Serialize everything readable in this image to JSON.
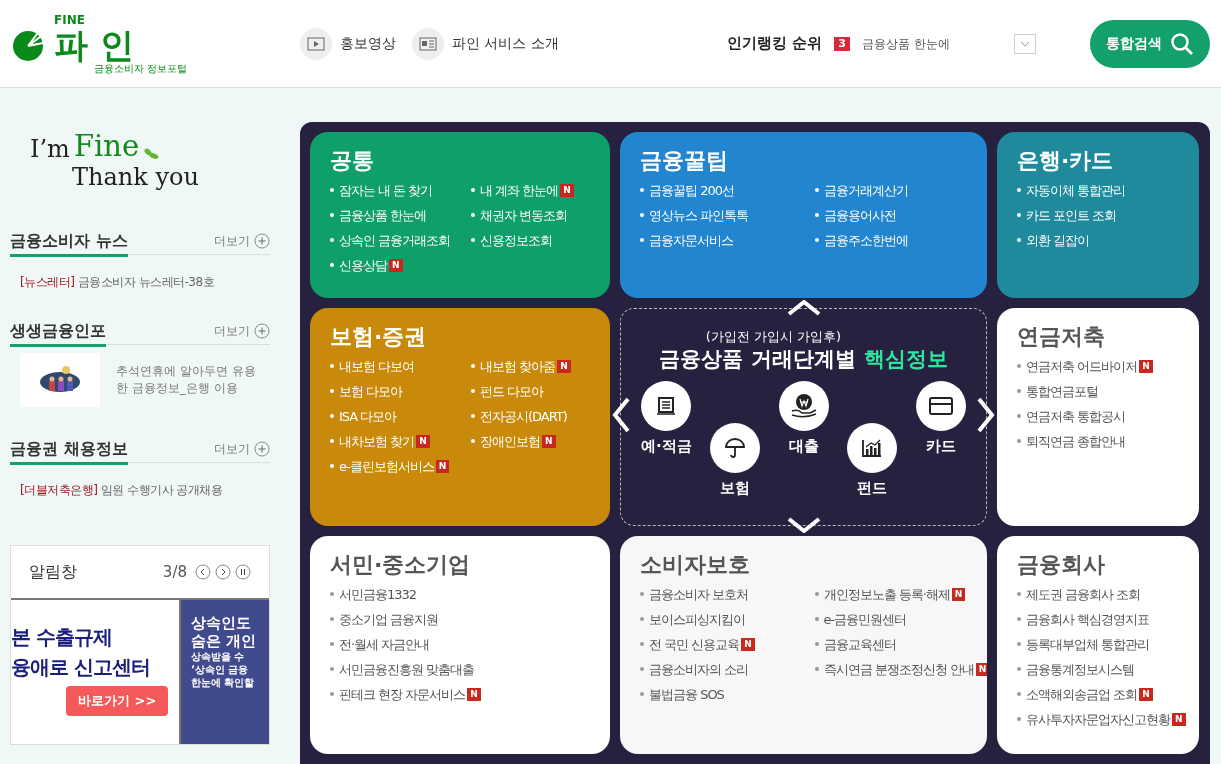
{
  "header": {
    "logo": {
      "top": "FINE",
      "name": "파 인",
      "tagline": "금융소비자 정보포털"
    },
    "nav": [
      {
        "label": "홍보영상",
        "kind": "video"
      },
      {
        "label": "파인 서비스 소개",
        "kind": "card"
      }
    ],
    "ranking": {
      "label": "인기랭킹 순위",
      "rank": "3",
      "text": "금융상품 한눈에"
    },
    "search_button": "통합검색"
  },
  "slogan": {
    "im": "I’m",
    "fine": "Fine",
    "thanks": "Thank you"
  },
  "sections": [
    {
      "title": "금융소비자 뉴스",
      "more": "더보기",
      "kind": "text",
      "tag": "[뉴스레터]",
      "text": "금융소비자 뉴스레터-38호"
    },
    {
      "title": "생생금융인포",
      "more": "더보기",
      "kind": "thumb",
      "text": "추석연휴에 알아두면 유용한 금융정보_은행 이용"
    },
    {
      "title": "금융권 채용정보",
      "more": "더보기",
      "kind": "text",
      "tag": "[더블저축은행]",
      "text": "임원 수행기사 공개채용"
    }
  ],
  "alert": {
    "title": "알림창",
    "counter": "3/8",
    "slides": [
      {
        "kind": "light",
        "lines": [
          "본 수출규제",
          "융애로 신고센터"
        ],
        "button": "바로가기 >>"
      },
      {
        "kind": "dark",
        "lines": [
          "상속인도",
          "숨은 개인"
        ],
        "sub": [
          "상속받을 수",
          "‘상속인 금융",
          "한눈에 확인할"
        ]
      }
    ]
  },
  "cards": [
    {
      "title": "공통",
      "kind": "filled",
      "color": "#0f9f6a",
      "columns": [
        [
          {
            "text": "잠자는 내 돈 찾기"
          },
          {
            "text": "금융상품 한눈에"
          },
          {
            "text": "상속인 금융거래조회"
          },
          {
            "text": "신용상담",
            "badge": "N"
          }
        ],
        [
          {
            "text": "내 계좌 한눈에",
            "badge": "N"
          },
          {
            "text": "채권자 변동조회"
          },
          {
            "text": "신용정보조회"
          }
        ]
      ]
    },
    {
      "title": "금융꿀팁",
      "kind": "filled",
      "color": "#2185d0",
      "columns": [
        [
          {
            "text": "금융꿀팁 200선"
          },
          {
            "text": "영상뉴스 파인톡톡"
          },
          {
            "text": "금융자문서비스"
          }
        ],
        [
          {
            "text": "금융거래계산기"
          },
          {
            "text": "금융용어사전"
          },
          {
            "text": "금융주소한번에"
          }
        ]
      ]
    },
    {
      "title": "은행·카드",
      "kind": "filled",
      "color": "#1e8a9c",
      "columns": [
        [
          {
            "text": "자동이체 통합관리"
          },
          {
            "text": "카드 포인트 조회"
          },
          {
            "text": "외환 길잡이"
          }
        ]
      ]
    },
    {
      "title": "보험·증권",
      "kind": "filled",
      "color": "#c98a0c",
      "columns": [
        [
          {
            "text": "내보험 다보여"
          },
          {
            "text": "보험 다모아"
          },
          {
            "text": "ISA 다모아"
          },
          {
            "text": "내차보험 찾기",
            "badge": "N"
          },
          {
            "text": "e-클린보험서비스",
            "badge": "N"
          }
        ],
        [
          {
            "text": "내보험 찾아줌",
            "badge": "N"
          },
          {
            "text": "펀드 다모아"
          },
          {
            "text": "전자공시(DART)"
          },
          {
            "text": "장애인보험",
            "badge": "N"
          }
        ]
      ]
    },
    {
      "kind": "center"
    },
    {
      "title": "연금저축",
      "kind": "plain",
      "color": "#ffffff",
      "columns": [
        [
          {
            "text": "연금저축 어드바이저",
            "badge": "N"
          },
          {
            "text": "통합연금포털"
          },
          {
            "text": "연금저축 통합공시"
          },
          {
            "text": "퇴직연금 종합안내"
          }
        ]
      ]
    },
    {
      "title": "서민·중소기업",
      "kind": "plain",
      "color": "#ffffff",
      "columns": [
        [
          {
            "text": "서민금융1332"
          },
          {
            "text": "중소기업 금융지원"
          },
          {
            "text": "전·월세 자금안내"
          },
          {
            "text": "서민금융진흥원 맞춤대출"
          },
          {
            "text": "핀테크 현장 자문서비스",
            "badge": "N"
          }
        ]
      ]
    },
    {
      "title": "소비자보호",
      "kind": "plain",
      "color": "#f7f7f7",
      "columns": [
        [
          {
            "text": "금융소비자 보호처"
          },
          {
            "text": "보이스피싱지킴이"
          },
          {
            "text": "전 국민 신용교육",
            "badge": "N"
          },
          {
            "text": "금융소비자의 소리"
          },
          {
            "text": "불법금융 SOS"
          }
        ],
        [
          {
            "text": "개인정보노출 등록·해제",
            "badge": "N"
          },
          {
            "text": "e-금융민원센터"
          },
          {
            "text": "금융교육센터"
          },
          {
            "text": "즉시연금 분쟁조정신청 안내",
            "badge": "N"
          }
        ]
      ]
    },
    {
      "title": "금융회사",
      "kind": "plain",
      "color": "#ffffff",
      "columns": [
        [
          {
            "text": "제도권 금융회사 조회"
          },
          {
            "text": "금융회사 핵심경영지표"
          },
          {
            "text": "등록대부업체 통합관리"
          },
          {
            "text": "금융통계정보시스템"
          },
          {
            "text": "소액해외송금업 조회",
            "badge": "N"
          },
          {
            "text": "유사투자자문업자신고현황",
            "badge": "N"
          }
        ]
      ]
    }
  ],
  "center": {
    "subtitle": "(가입전 가입시 가입후)",
    "title": "금융상품 거래단계별",
    "highlight": "핵심정보",
    "products": [
      {
        "label": "예·적금",
        "kind": "ledger"
      },
      {
        "label": "보험",
        "kind": "umbrella"
      },
      {
        "label": "대출",
        "kind": "coin"
      },
      {
        "label": "펀드",
        "kind": "chart"
      },
      {
        "label": "카드",
        "kind": "card"
      }
    ]
  }
}
